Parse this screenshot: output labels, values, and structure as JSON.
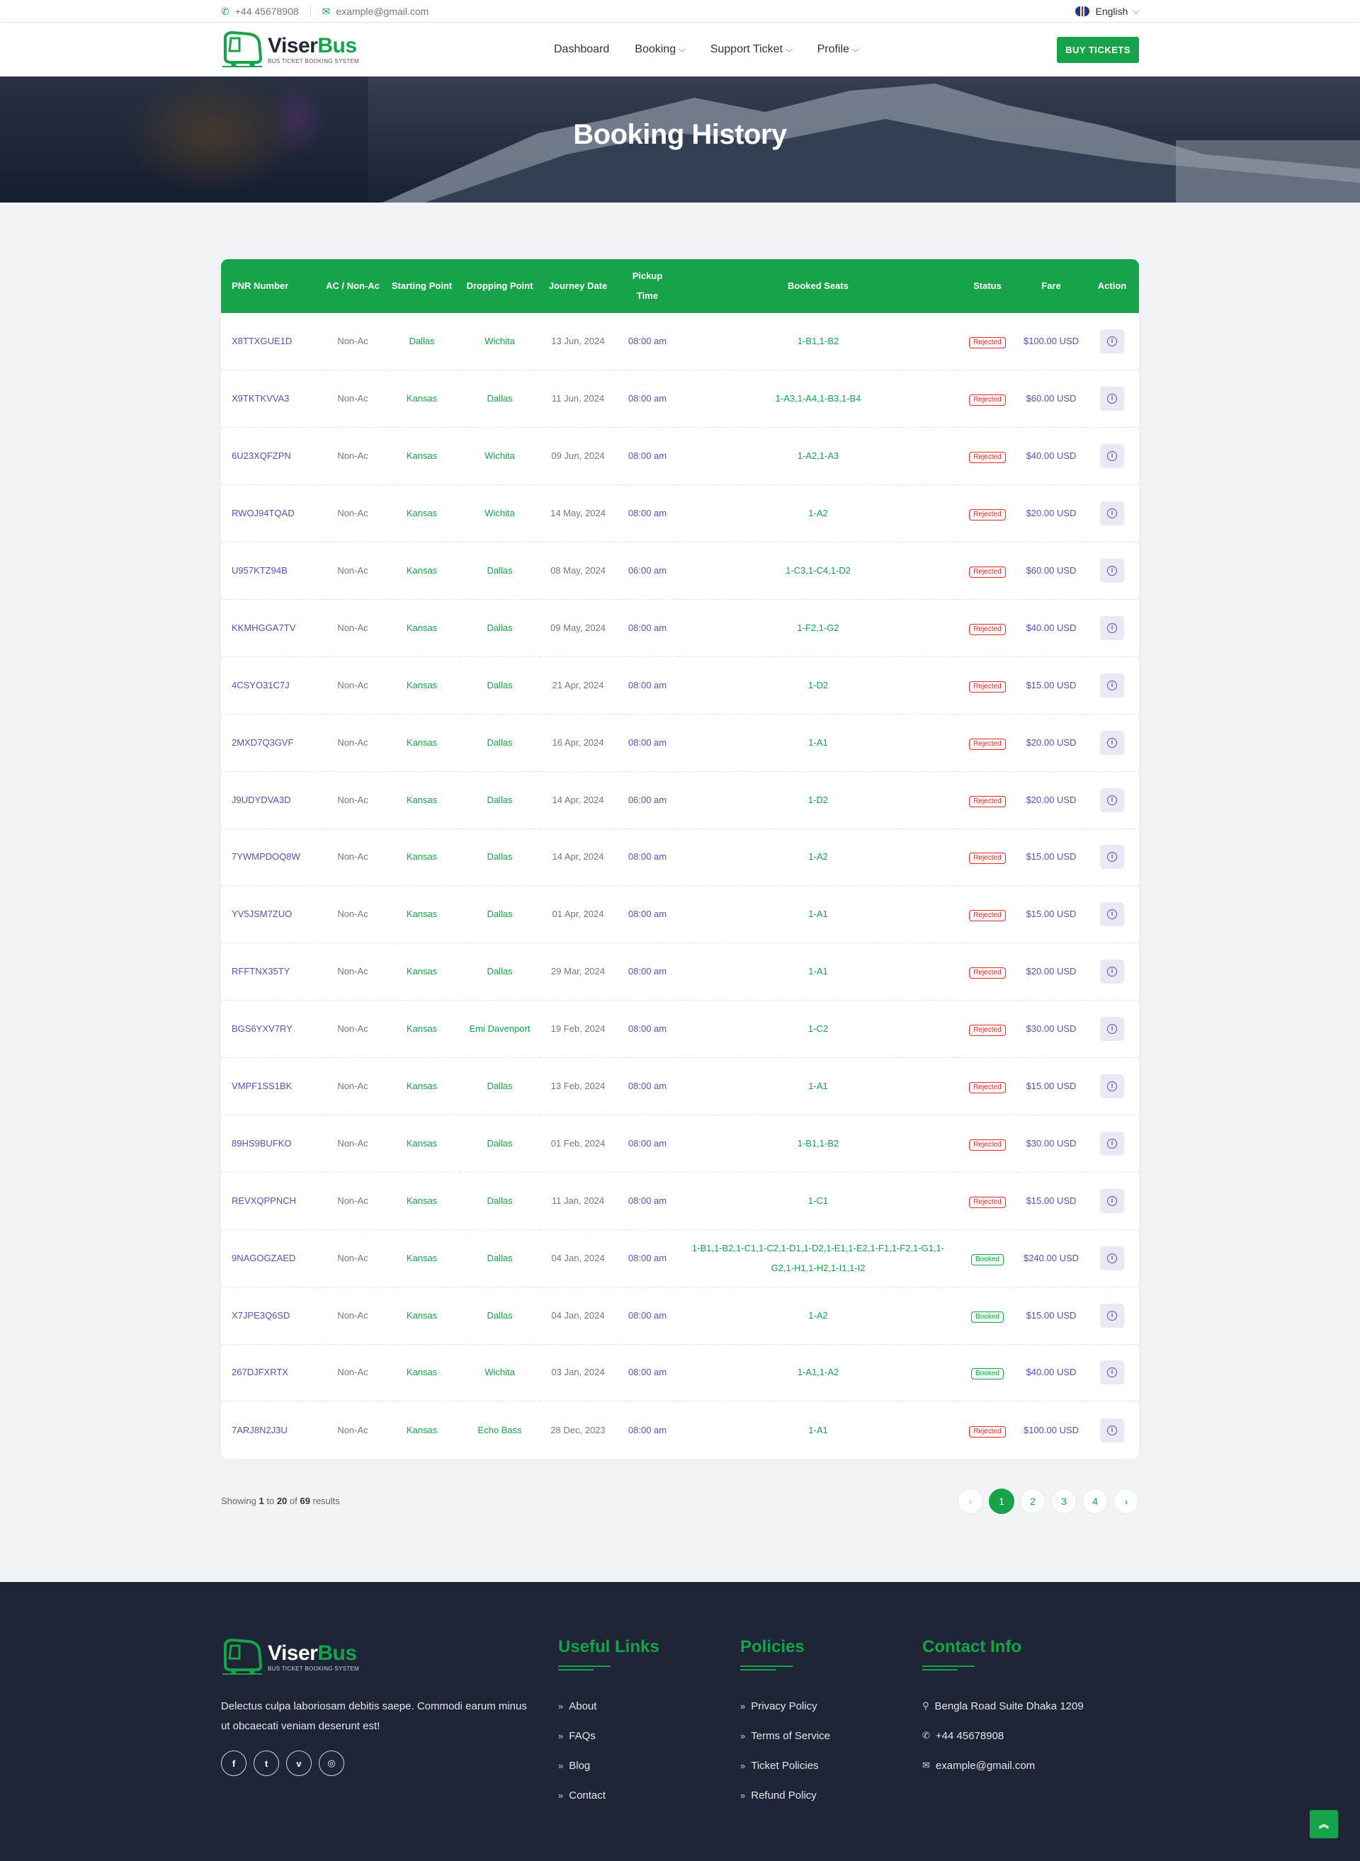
{
  "topbar": {
    "phone": "+44 45678908",
    "email": "example@gmail.com",
    "language": "English"
  },
  "header": {
    "brand_part1": "Viser",
    "brand_part2": "Bus",
    "tagline": "BUS TICKET BOOKING SYSTEM",
    "nav": [
      "Dashboard",
      "Booking",
      "Support Ticket",
      "Profile"
    ],
    "buy_label": "BUY TICKETS"
  },
  "banner": {
    "title": "Booking History"
  },
  "table": {
    "headers": {
      "pnr": "PNR Number",
      "ac": "AC / Non-Ac",
      "start": "Starting Point",
      "drop": "Dropping Point",
      "date": "Journey Date",
      "time": "Pickup Time",
      "seats": "Booked Seats",
      "status": "Status",
      "fare": "Fare",
      "action": "Action"
    },
    "rows": [
      {
        "pnr": "X8TTXGUE1D",
        "ac": "Non-Ac",
        "start": "Dallas",
        "drop": "Wichita",
        "date": "13 Jun, 2024",
        "time": "08:00 am",
        "seats": "1-B1,1-B2",
        "status": "Rejected",
        "fare": "$100.00 USD"
      },
      {
        "pnr": "X9TKTKVVA3",
        "ac": "Non-Ac",
        "start": "Kansas",
        "drop": "Dallas",
        "date": "11 Jun, 2024",
        "time": "08:00 am",
        "seats": "1-A3,1-A4,1-B3,1-B4",
        "status": "Rejected",
        "fare": "$60.00 USD"
      },
      {
        "pnr": "6U23XQFZPN",
        "ac": "Non-Ac",
        "start": "Kansas",
        "drop": "Wichita",
        "date": "09 Jun, 2024",
        "time": "08:00 am",
        "seats": "1-A2,1-A3",
        "status": "Rejected",
        "fare": "$40.00 USD"
      },
      {
        "pnr": "RWOJ94TQAD",
        "ac": "Non-Ac",
        "start": "Kansas",
        "drop": "Wichita",
        "date": "14 May, 2024",
        "time": "08:00 am",
        "seats": "1-A2",
        "status": "Rejected",
        "fare": "$20.00 USD"
      },
      {
        "pnr": "U957KTZ94B",
        "ac": "Non-Ac",
        "start": "Kansas",
        "drop": "Dallas",
        "date": "08 May, 2024",
        "time": "06:00 am",
        "seats": "1-C3,1-C4,1-D2",
        "status": "Rejected",
        "fare": "$60.00 USD"
      },
      {
        "pnr": "KKMHGGA7TV",
        "ac": "Non-Ac",
        "start": "Kansas",
        "drop": "Dallas",
        "date": "09 May, 2024",
        "time": "08:00 am",
        "seats": "1-F2,1-G2",
        "status": "Rejected",
        "fare": "$40.00 USD"
      },
      {
        "pnr": "4CSYO31C7J",
        "ac": "Non-Ac",
        "start": "Kansas",
        "drop": "Dallas",
        "date": "21 Apr, 2024",
        "time": "08:00 am",
        "seats": "1-D2",
        "status": "Rejected",
        "fare": "$15.00 USD"
      },
      {
        "pnr": "2MXD7Q3GVF",
        "ac": "Non-Ac",
        "start": "Kansas",
        "drop": "Dallas",
        "date": "16 Apr, 2024",
        "time": "08:00 am",
        "seats": "1-A1",
        "status": "Rejected",
        "fare": "$20.00 USD"
      },
      {
        "pnr": "J9UDYDVA3D",
        "ac": "Non-Ac",
        "start": "Kansas",
        "drop": "Dallas",
        "date": "14 Apr, 2024",
        "time": "06:00 am",
        "seats": "1-D2",
        "status": "Rejected",
        "fare": "$20.00 USD"
      },
      {
        "pnr": "7YWMPDOQ8W",
        "ac": "Non-Ac",
        "start": "Kansas",
        "drop": "Dallas",
        "date": "14 Apr, 2024",
        "time": "08:00 am",
        "seats": "1-A2",
        "status": "Rejected",
        "fare": "$15.00 USD"
      },
      {
        "pnr": "YV5JSM7ZUO",
        "ac": "Non-Ac",
        "start": "Kansas",
        "drop": "Dallas",
        "date": "01 Apr, 2024",
        "time": "08:00 am",
        "seats": "1-A1",
        "status": "Rejected",
        "fare": "$15.00 USD"
      },
      {
        "pnr": "RFFTNX35TY",
        "ac": "Non-Ac",
        "start": "Kansas",
        "drop": "Dallas",
        "date": "29 Mar, 2024",
        "time": "08:00 am",
        "seats": "1-A1",
        "status": "Rejected",
        "fare": "$20.00 USD"
      },
      {
        "pnr": "BGS6YXV7RY",
        "ac": "Non-Ac",
        "start": "Kansas",
        "drop": "Emi Davenport",
        "date": "19 Feb, 2024",
        "time": "08:00 am",
        "seats": "1-C2",
        "status": "Rejected",
        "fare": "$30.00 USD"
      },
      {
        "pnr": "VMPF1SS1BK",
        "ac": "Non-Ac",
        "start": "Kansas",
        "drop": "Dallas",
        "date": "13 Feb, 2024",
        "time": "08:00 am",
        "seats": "1-A1",
        "status": "Rejected",
        "fare": "$15.00 USD"
      },
      {
        "pnr": "89HS9BUFKO",
        "ac": "Non-Ac",
        "start": "Kansas",
        "drop": "Dallas",
        "date": "01 Feb, 2024",
        "time": "08:00 am",
        "seats": "1-B1,1-B2",
        "status": "Rejected",
        "fare": "$30.00 USD"
      },
      {
        "pnr": "REVXQPPNCH",
        "ac": "Non-Ac",
        "start": "Kansas",
        "drop": "Dallas",
        "date": "11 Jan, 2024",
        "time": "08:00 am",
        "seats": "1-C1",
        "status": "Rejected",
        "fare": "$15.00 USD"
      },
      {
        "pnr": "9NAGOGZAED",
        "ac": "Non-Ac",
        "start": "Kansas",
        "drop": "Dallas",
        "date": "04 Jan, 2024",
        "time": "08:00 am",
        "seats": "1-B1,1-B2,1-C1,1-C2,1-D1,1-D2,1-E1,1-E2,1-F1,1-F2,1-G1,1-G2,1-H1,1-H2,1-I1,1-I2",
        "status": "Booked",
        "fare": "$240.00 USD"
      },
      {
        "pnr": "X7JPE3Q6SD",
        "ac": "Non-Ac",
        "start": "Kansas",
        "drop": "Dallas",
        "date": "04 Jan, 2024",
        "time": "08:00 am",
        "seats": "1-A2",
        "status": "Booked",
        "fare": "$15.00 USD"
      },
      {
        "pnr": "267DJFXRTX",
        "ac": "Non-Ac",
        "start": "Kansas",
        "drop": "Wichita",
        "date": "03 Jan, 2024",
        "time": "08:00 am",
        "seats": "1-A1,1-A2",
        "status": "Booked",
        "fare": "$40.00 USD"
      },
      {
        "pnr": "7ARJ8N2J3U",
        "ac": "Non-Ac",
        "start": "Kansas",
        "drop": "Echo Bass",
        "date": "28 Dec, 2023",
        "time": "08:00 am",
        "seats": "1-A1",
        "status": "Rejected",
        "fare": "$100.00 USD"
      }
    ]
  },
  "pagination": {
    "showing_prefix": "Showing",
    "from": "1",
    "to_word": "to",
    "to": "20",
    "of_word": "of",
    "total": "69",
    "suffix": "results",
    "prev": "‹",
    "pages": [
      "1",
      "2",
      "3",
      "4"
    ],
    "next": "›",
    "current": "1"
  },
  "footer": {
    "description": "Delectus culpa laboriosam debitis saepe. Commodi earum minus ut obcaecati veniam deserunt est!",
    "socials": [
      "facebook",
      "twitter",
      "vimeo",
      "instagram"
    ],
    "useful_links": {
      "title": "Useful Links",
      "items": [
        "About",
        "FAQs",
        "Blog",
        "Contact"
      ]
    },
    "policies": {
      "title": "Policies",
      "items": [
        "Privacy Policy",
        "Terms of Service",
        "Ticket Policies",
        "Refund Policy"
      ]
    },
    "contact": {
      "title": "Contact Info",
      "address": "Bengla Road Suite Dhaka 1209",
      "phone": "+44 45678908",
      "email": "example@gmail.com"
    }
  },
  "colors": {
    "accent": "#17a34a",
    "link": "#5b4fb8",
    "rejected": "#e03131",
    "footer_bg": "#1d2537"
  }
}
